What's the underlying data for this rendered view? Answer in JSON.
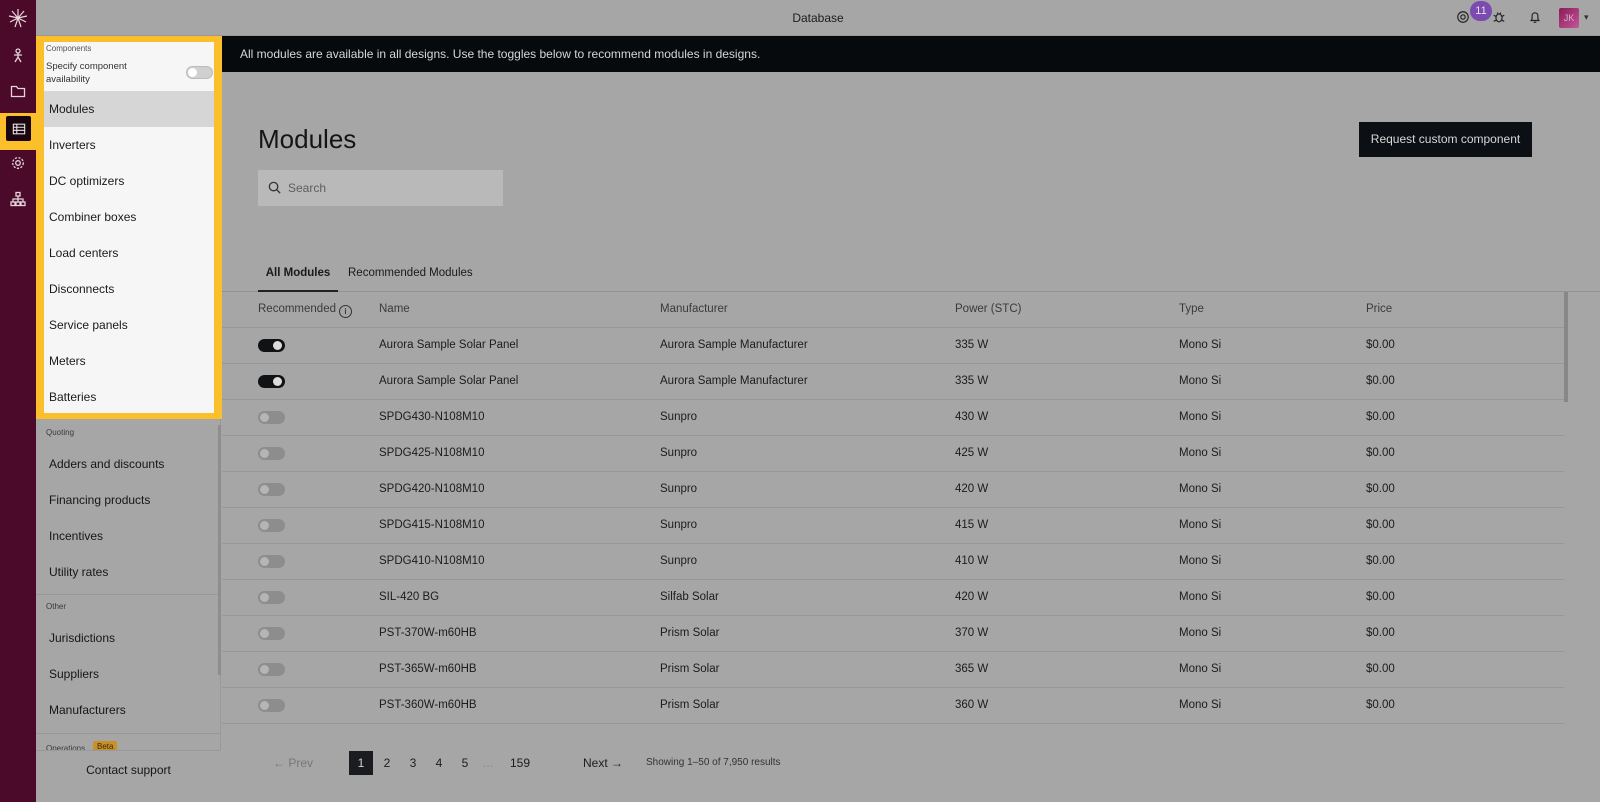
{
  "topbar": {
    "title": "Database",
    "badge_count": "11",
    "avatar_initials": "JK"
  },
  "sidebar": {
    "components": {
      "section_label": "Components",
      "specify_label": "Specify component availability",
      "items": [
        {
          "label": "Modules",
          "active": true
        },
        {
          "label": "Inverters"
        },
        {
          "label": "DC optimizers"
        },
        {
          "label": "Combiner boxes"
        },
        {
          "label": "Load centers"
        },
        {
          "label": "Disconnects"
        },
        {
          "label": "Service panels"
        },
        {
          "label": "Meters"
        },
        {
          "label": "Batteries"
        }
      ]
    },
    "quoting": {
      "section_label": "Quoting",
      "items": [
        {
          "label": "Adders and discounts"
        },
        {
          "label": "Financing products"
        },
        {
          "label": "Incentives"
        },
        {
          "label": "Utility rates"
        }
      ]
    },
    "other": {
      "section_label": "Other",
      "items": [
        {
          "label": "Jurisdictions"
        },
        {
          "label": "Suppliers"
        },
        {
          "label": "Manufacturers"
        }
      ]
    },
    "operations": {
      "section_label": "Operations",
      "badge": "Beta"
    },
    "contact_support": "Contact support"
  },
  "banner": {
    "text": "All modules are available in all designs. Use the toggles below to recommend modules in designs."
  },
  "main": {
    "title": "Modules",
    "request_button": "Request custom component",
    "search_placeholder": "Search",
    "tabs": [
      {
        "label": "All Modules",
        "active": true
      },
      {
        "label": "Recommended Modules"
      }
    ],
    "table": {
      "headers": {
        "recommended": "Recommended",
        "name": "Name",
        "manufacturer": "Manufacturer",
        "power": "Power (STC)",
        "type": "Type",
        "price": "Price"
      },
      "rows": [
        {
          "recommended": true,
          "name": "Aurora Sample Solar Panel",
          "manufacturer": "Aurora Sample Manufacturer",
          "power": "335 W",
          "type": "Mono Si",
          "price": "$0.00"
        },
        {
          "recommended": true,
          "name": "Aurora Sample Solar Panel",
          "manufacturer": "Aurora Sample Manufacturer",
          "power": "335 W",
          "type": "Mono Si",
          "price": "$0.00"
        },
        {
          "recommended": false,
          "name": "SPDG430-N108M10",
          "manufacturer": "Sunpro",
          "power": "430 W",
          "type": "Mono Si",
          "price": "$0.00"
        },
        {
          "recommended": false,
          "name": "SPDG425-N108M10",
          "manufacturer": "Sunpro",
          "power": "425 W",
          "type": "Mono Si",
          "price": "$0.00"
        },
        {
          "recommended": false,
          "name": "SPDG420-N108M10",
          "manufacturer": "Sunpro",
          "power": "420 W",
          "type": "Mono Si",
          "price": "$0.00"
        },
        {
          "recommended": false,
          "name": "SPDG415-N108M10",
          "manufacturer": "Sunpro",
          "power": "415 W",
          "type": "Mono Si",
          "price": "$0.00"
        },
        {
          "recommended": false,
          "name": "SPDG410-N108M10",
          "manufacturer": "Sunpro",
          "power": "410 W",
          "type": "Mono Si",
          "price": "$0.00"
        },
        {
          "recommended": false,
          "name": "SIL-420 BG",
          "manufacturer": "Silfab Solar",
          "power": "420 W",
          "type": "Mono Si",
          "price": "$0.00"
        },
        {
          "recommended": false,
          "name": "PST-370W-m60HB",
          "manufacturer": "Prism Solar",
          "power": "370 W",
          "type": "Mono Si",
          "price": "$0.00"
        },
        {
          "recommended": false,
          "name": "PST-365W-m60HB",
          "manufacturer": "Prism Solar",
          "power": "365 W",
          "type": "Mono Si",
          "price": "$0.00"
        },
        {
          "recommended": false,
          "name": "PST-360W-m60HB",
          "manufacturer": "Prism Solar",
          "power": "360 W",
          "type": "Mono Si",
          "price": "$0.00"
        }
      ]
    },
    "pagination": {
      "prev": "Prev",
      "next": "Next",
      "pages": [
        "1",
        "2",
        "3",
        "4",
        "5"
      ],
      "ellipsis": "...",
      "last": "159",
      "current": "1",
      "showing": "Showing 1–50 of 7,950 results"
    }
  },
  "colors": {
    "rail": "#4b0a2a",
    "highlight": "#fbbf2b",
    "banner": "#070a0d",
    "primary_button": "#0c0f13"
  }
}
